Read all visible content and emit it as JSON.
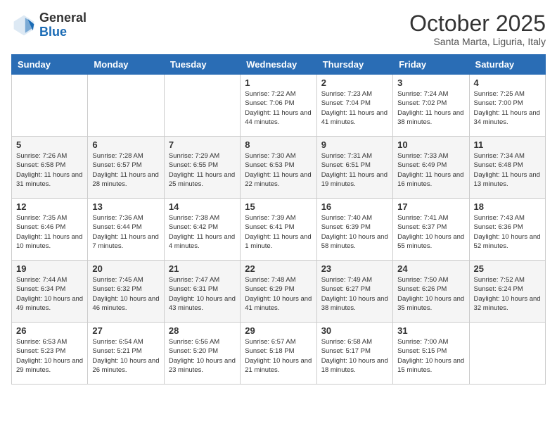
{
  "logo": {
    "general": "General",
    "blue": "Blue"
  },
  "header": {
    "month": "October 2025",
    "location": "Santa Marta, Liguria, Italy"
  },
  "weekdays": [
    "Sunday",
    "Monday",
    "Tuesday",
    "Wednesday",
    "Thursday",
    "Friday",
    "Saturday"
  ],
  "weeks": [
    [
      {
        "day": "",
        "info": ""
      },
      {
        "day": "",
        "info": ""
      },
      {
        "day": "",
        "info": ""
      },
      {
        "day": "1",
        "info": "Sunrise: 7:22 AM\nSunset: 7:06 PM\nDaylight: 11 hours and 44 minutes."
      },
      {
        "day": "2",
        "info": "Sunrise: 7:23 AM\nSunset: 7:04 PM\nDaylight: 11 hours and 41 minutes."
      },
      {
        "day": "3",
        "info": "Sunrise: 7:24 AM\nSunset: 7:02 PM\nDaylight: 11 hours and 38 minutes."
      },
      {
        "day": "4",
        "info": "Sunrise: 7:25 AM\nSunset: 7:00 PM\nDaylight: 11 hours and 34 minutes."
      }
    ],
    [
      {
        "day": "5",
        "info": "Sunrise: 7:26 AM\nSunset: 6:58 PM\nDaylight: 11 hours and 31 minutes."
      },
      {
        "day": "6",
        "info": "Sunrise: 7:28 AM\nSunset: 6:57 PM\nDaylight: 11 hours and 28 minutes."
      },
      {
        "day": "7",
        "info": "Sunrise: 7:29 AM\nSunset: 6:55 PM\nDaylight: 11 hours and 25 minutes."
      },
      {
        "day": "8",
        "info": "Sunrise: 7:30 AM\nSunset: 6:53 PM\nDaylight: 11 hours and 22 minutes."
      },
      {
        "day": "9",
        "info": "Sunrise: 7:31 AM\nSunset: 6:51 PM\nDaylight: 11 hours and 19 minutes."
      },
      {
        "day": "10",
        "info": "Sunrise: 7:33 AM\nSunset: 6:49 PM\nDaylight: 11 hours and 16 minutes."
      },
      {
        "day": "11",
        "info": "Sunrise: 7:34 AM\nSunset: 6:48 PM\nDaylight: 11 hours and 13 minutes."
      }
    ],
    [
      {
        "day": "12",
        "info": "Sunrise: 7:35 AM\nSunset: 6:46 PM\nDaylight: 11 hours and 10 minutes."
      },
      {
        "day": "13",
        "info": "Sunrise: 7:36 AM\nSunset: 6:44 PM\nDaylight: 11 hours and 7 minutes."
      },
      {
        "day": "14",
        "info": "Sunrise: 7:38 AM\nSunset: 6:42 PM\nDaylight: 11 hours and 4 minutes."
      },
      {
        "day": "15",
        "info": "Sunrise: 7:39 AM\nSunset: 6:41 PM\nDaylight: 11 hours and 1 minute."
      },
      {
        "day": "16",
        "info": "Sunrise: 7:40 AM\nSunset: 6:39 PM\nDaylight: 10 hours and 58 minutes."
      },
      {
        "day": "17",
        "info": "Sunrise: 7:41 AM\nSunset: 6:37 PM\nDaylight: 10 hours and 55 minutes."
      },
      {
        "day": "18",
        "info": "Sunrise: 7:43 AM\nSunset: 6:36 PM\nDaylight: 10 hours and 52 minutes."
      }
    ],
    [
      {
        "day": "19",
        "info": "Sunrise: 7:44 AM\nSunset: 6:34 PM\nDaylight: 10 hours and 49 minutes."
      },
      {
        "day": "20",
        "info": "Sunrise: 7:45 AM\nSunset: 6:32 PM\nDaylight: 10 hours and 46 minutes."
      },
      {
        "day": "21",
        "info": "Sunrise: 7:47 AM\nSunset: 6:31 PM\nDaylight: 10 hours and 43 minutes."
      },
      {
        "day": "22",
        "info": "Sunrise: 7:48 AM\nSunset: 6:29 PM\nDaylight: 10 hours and 41 minutes."
      },
      {
        "day": "23",
        "info": "Sunrise: 7:49 AM\nSunset: 6:27 PM\nDaylight: 10 hours and 38 minutes."
      },
      {
        "day": "24",
        "info": "Sunrise: 7:50 AM\nSunset: 6:26 PM\nDaylight: 10 hours and 35 minutes."
      },
      {
        "day": "25",
        "info": "Sunrise: 7:52 AM\nSunset: 6:24 PM\nDaylight: 10 hours and 32 minutes."
      }
    ],
    [
      {
        "day": "26",
        "info": "Sunrise: 6:53 AM\nSunset: 5:23 PM\nDaylight: 10 hours and 29 minutes."
      },
      {
        "day": "27",
        "info": "Sunrise: 6:54 AM\nSunset: 5:21 PM\nDaylight: 10 hours and 26 minutes."
      },
      {
        "day": "28",
        "info": "Sunrise: 6:56 AM\nSunset: 5:20 PM\nDaylight: 10 hours and 23 minutes."
      },
      {
        "day": "29",
        "info": "Sunrise: 6:57 AM\nSunset: 5:18 PM\nDaylight: 10 hours and 21 minutes."
      },
      {
        "day": "30",
        "info": "Sunrise: 6:58 AM\nSunset: 5:17 PM\nDaylight: 10 hours and 18 minutes."
      },
      {
        "day": "31",
        "info": "Sunrise: 7:00 AM\nSunset: 5:15 PM\nDaylight: 10 hours and 15 minutes."
      },
      {
        "day": "",
        "info": ""
      }
    ]
  ]
}
